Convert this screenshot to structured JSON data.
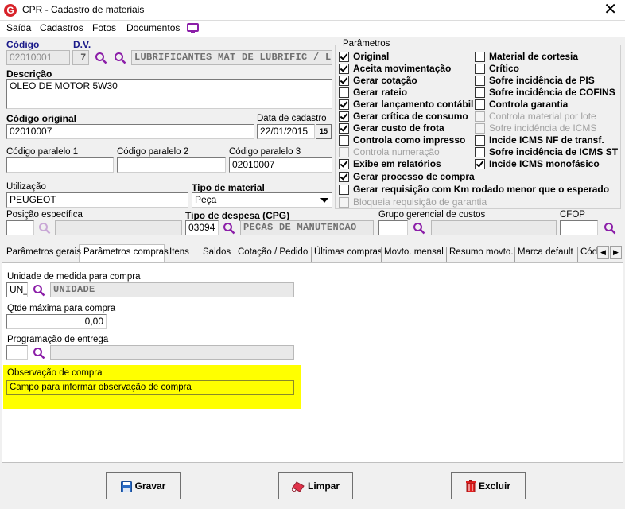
{
  "window": {
    "title": "CPR - Cadastro de materiais",
    "logo_letter": "G"
  },
  "menu": {
    "items": [
      "Saída",
      "Cadastros",
      "Fotos",
      "Documentos"
    ]
  },
  "form": {
    "codigo_label": "Código",
    "codigo_value": "02010001",
    "dv_label": "D.V.",
    "dv_value": "7",
    "grupo_value": "LUBRIFICANTES MAT DE LUBRIFIC / LUBI",
    "descricao_label": "Descrição",
    "descricao_value": "OLEO DE MOTOR 5W30",
    "codigo_original_label": "Código original",
    "codigo_original_value": "02010007",
    "data_cadastro_label": "Data de cadastro",
    "data_cadastro_value": "22/01/2015",
    "calendar_label": "15",
    "codigo_paralelo1_label": "Código paralelo 1",
    "codigo_paralelo1_value": "",
    "codigo_paralelo2_label": "Código paralelo 2",
    "codigo_paralelo2_value": "",
    "codigo_paralelo3_label": "Código paralelo 3",
    "codigo_paralelo3_value": "02010007",
    "utilizacao_label": "Utilização",
    "utilizacao_value": "PEUGEOT",
    "tipo_material_label": "Tipo de material",
    "tipo_material_value": "Peça",
    "posicao_label": "Posição específica",
    "posicao_value": "",
    "tipo_despesa_label": "Tipo de despesa (CPG)",
    "tipo_despesa_code": "03094",
    "tipo_despesa_desc": "PECAS DE MANUTENCAO",
    "grupo_gerencial_label": "Grupo gerencial de custos",
    "grupo_gerencial_value": "",
    "cfop_label": "CFOP",
    "cfop_value": ""
  },
  "parametros": {
    "title": "Parâmetros",
    "left": [
      {
        "label": "Original",
        "checked": true,
        "disabled": false
      },
      {
        "label": "Aceita movimentação",
        "checked": true,
        "disabled": false
      },
      {
        "label": "Gerar cotação",
        "checked": true,
        "disabled": false
      },
      {
        "label": "Gerar rateio",
        "checked": false,
        "disabled": false
      },
      {
        "label": "Gerar lançamento contábil",
        "checked": true,
        "disabled": false
      },
      {
        "label": "Gerar crítica de consumo",
        "checked": true,
        "disabled": false
      },
      {
        "label": "Gerar custo de frota",
        "checked": true,
        "disabled": false
      },
      {
        "label": "Controla como impresso",
        "checked": false,
        "disabled": false
      },
      {
        "label": "Controla numeração",
        "checked": false,
        "disabled": true
      },
      {
        "label": "Exibe em relatórios",
        "checked": true,
        "disabled": false
      },
      {
        "label": "Gerar processo de compra",
        "checked": true,
        "disabled": false
      },
      {
        "label": "Gerar requisição com Km rodado menor que o esperado",
        "checked": false,
        "disabled": false
      },
      {
        "label": "Bloqueia requisição de garantia",
        "checked": false,
        "disabled": true
      }
    ],
    "right": [
      {
        "label": "Material de cortesia",
        "checked": false,
        "disabled": false
      },
      {
        "label": "Crítico",
        "checked": false,
        "disabled": false
      },
      {
        "label": "Sofre incidência de PIS",
        "checked": false,
        "disabled": false
      },
      {
        "label": "Sofre incidência de COFINS",
        "checked": false,
        "disabled": false
      },
      {
        "label": "Controla garantia",
        "checked": false,
        "disabled": false
      },
      {
        "label": "Controla material por lote",
        "checked": false,
        "disabled": true
      },
      {
        "label": "Sofre incidência de ICMS",
        "checked": false,
        "disabled": true
      },
      {
        "label": "Incide ICMS NF de transf.",
        "checked": false,
        "disabled": false
      },
      {
        "label": "Sofre incidência de ICMS ST",
        "checked": false,
        "disabled": false
      },
      {
        "label": "Incide ICMS monofásico",
        "checked": true,
        "disabled": false
      }
    ]
  },
  "tabs": [
    "Parâmetros gerais",
    "Parâmetros compras",
    "Itens",
    "Saldos",
    "Cotação / Pedido",
    "Últimas compras",
    "Movto. mensal",
    "Resumo movto.",
    "Marca default",
    "Códi"
  ],
  "active_tab": 1,
  "compras": {
    "unidade_label": "Unidade de medida para compra",
    "unidade_code": "UN_",
    "unidade_desc": "UNIDADE",
    "qtde_label": "Qtde máxima para compra",
    "qtde_value": "0,00",
    "programacao_label": "Programação de entrega",
    "programacao_code": "",
    "programacao_desc": "",
    "observacao_label": "Observação de compra",
    "observacao_value": "Campo para informar observação de compra"
  },
  "buttons": {
    "gravar": "Gravar",
    "limpar": "Limpar",
    "excluir": "Excluir"
  },
  "colors": {
    "highlight": "#ffff00",
    "magnifier": "#8b1ea8",
    "logo": "#d8232a"
  }
}
